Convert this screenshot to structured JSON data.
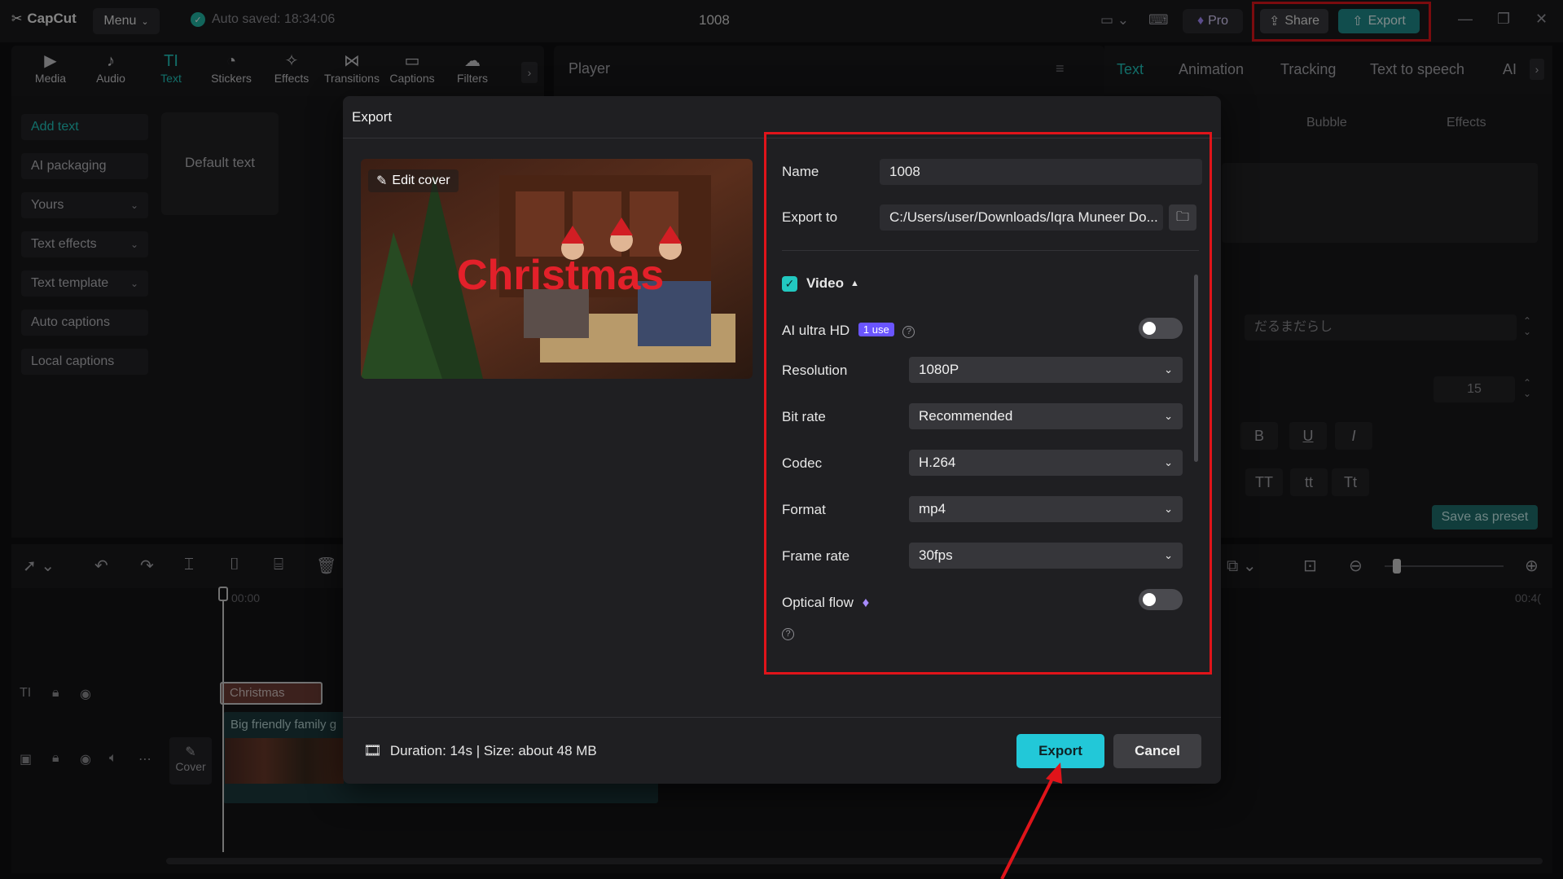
{
  "app": {
    "logo_text": "CapCut",
    "menu_label": "Menu",
    "autosave_text": "Auto saved: 18:34:06",
    "project_title": "1008",
    "pro_label": "Pro",
    "share_label": "Share",
    "export_label": "Export"
  },
  "tools": [
    {
      "label": "Media",
      "icon": "media-icon",
      "glyph": "▶"
    },
    {
      "label": "Audio",
      "icon": "audio-icon",
      "glyph": "♪"
    },
    {
      "label": "Text",
      "icon": "text-icon",
      "glyph": "TI"
    },
    {
      "label": "Stickers",
      "icon": "stickers-icon",
      "glyph": "◔"
    },
    {
      "label": "Effects",
      "icon": "effects-icon",
      "glyph": "✧"
    },
    {
      "label": "Transitions",
      "icon": "transitions-icon",
      "glyph": "⋈"
    },
    {
      "label": "Captions",
      "icon": "captions-icon",
      "glyph": "▭"
    },
    {
      "label": "Filters",
      "icon": "filters-icon",
      "glyph": "☁"
    }
  ],
  "left_panel": {
    "items": [
      {
        "label": "Add text",
        "chevron": ""
      },
      {
        "label": "AI packaging",
        "chevron": ""
      },
      {
        "label": "Yours",
        "chevron": "⌄"
      },
      {
        "label": "Text effects",
        "chevron": "⌄"
      },
      {
        "label": "Text template",
        "chevron": "⌄"
      },
      {
        "label": "Auto captions",
        "chevron": ""
      },
      {
        "label": "Local captions",
        "chevron": ""
      }
    ],
    "default_text": "Default text"
  },
  "player": {
    "label": "Player"
  },
  "right_panel": {
    "tabs": [
      "Text",
      "Animation",
      "Tracking",
      "Text to speech",
      "AI"
    ],
    "subtabs": [
      "Bubble",
      "Effects"
    ],
    "font_value": "だるまだらし",
    "size_value": "15",
    "format_buttons": [
      "B",
      "U",
      "I"
    ],
    "case_buttons": [
      "TT",
      "tt",
      "Tt"
    ],
    "save_preset": "Save as preset"
  },
  "timeline": {
    "time_start": "00:00",
    "time_end": "00:4(",
    "text_clip": "Christmas",
    "video_clip": "Big friendly family g",
    "cover_label": "Cover"
  },
  "dialog": {
    "title": "Export",
    "edit_cover": "Edit cover",
    "cover_caption": "Christmas",
    "name_label": "Name",
    "name_value": "1008",
    "export_to_label": "Export to",
    "export_to_value": "C:/Users/user/Downloads/Iqra Muneer Do...",
    "video_label": "Video",
    "ai_hd_label": "AI ultra HD",
    "ai_hd_badge": "1 use",
    "resolution_label": "Resolution",
    "resolution_value": "1080P",
    "bitrate_label": "Bit rate",
    "bitrate_value": "Recommended",
    "codec_label": "Codec",
    "codec_value": "H.264",
    "format_label": "Format",
    "format_value": "mp4",
    "framerate_label": "Frame rate",
    "framerate_value": "30fps",
    "optical_flow_label": "Optical flow",
    "duration_text": "Duration: 14s | Size: about 48 MB",
    "export_button": "Export",
    "cancel_button": "Cancel"
  },
  "colors": {
    "accent": "#22c8c0",
    "annotation_red": "#e0141a",
    "export_button": "#22c8d8"
  }
}
